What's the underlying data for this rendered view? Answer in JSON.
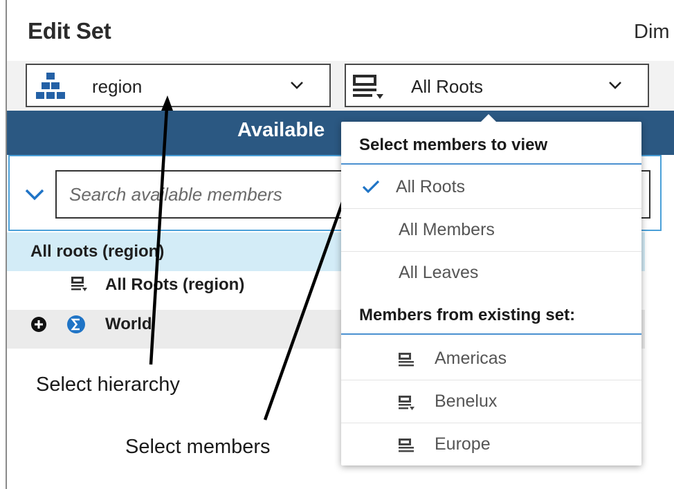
{
  "header": {
    "title": "Edit Set",
    "right_text": "Dim"
  },
  "hierarchy_select": {
    "label": "region",
    "icon": "hierarchy-icon"
  },
  "members_select": {
    "label": "All Roots",
    "icon": "member-list-icon"
  },
  "panel": {
    "title": "Available"
  },
  "search": {
    "placeholder": "Search available members"
  },
  "tree": {
    "group_label": "All roots (region)",
    "rows": [
      {
        "label": "All Roots (region)",
        "icon": "member-list-icon"
      },
      {
        "label": "World",
        "icon": "sigma-icon",
        "expand_icon": "plus-circle-icon"
      }
    ]
  },
  "dropdown": {
    "heading": "Select members to view",
    "items": [
      {
        "label": "All Roots",
        "checked": true
      },
      {
        "label": "All Members",
        "checked": false
      },
      {
        "label": "All Leaves",
        "checked": false
      }
    ],
    "section2_heading": "Members from existing set:",
    "sets": [
      {
        "label": "Americas"
      },
      {
        "label": "Benelux"
      },
      {
        "label": "Europe"
      }
    ]
  },
  "annotations": {
    "hierarchy_note": "Select hierarchy",
    "members_note": "Select members"
  },
  "colors": {
    "header_bar": "#2b5882",
    "accent_blue": "#1f74c6",
    "group_row": "#d3ecf7",
    "hierarchy_icon": "#2461a6"
  }
}
